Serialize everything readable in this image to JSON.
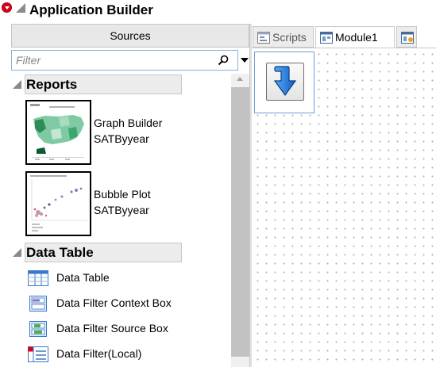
{
  "title": "Application Builder",
  "sources": {
    "header": "Sources",
    "filter_placeholder": "Filter"
  },
  "sections": {
    "reports": {
      "label": "Reports",
      "items": [
        {
          "line1": "Graph Builder",
          "line2": "SATByyear"
        },
        {
          "line1": "Bubble Plot",
          "line2": "SATByyear"
        }
      ]
    },
    "data_table": {
      "label": "Data Table",
      "items": [
        {
          "label": "Data Table"
        },
        {
          "label": "Data Filter Context Box"
        },
        {
          "label": "Data Filter Source Box"
        },
        {
          "label": "Data Filter(Local)"
        }
      ]
    }
  },
  "tabs": [
    {
      "label": "Scripts"
    },
    {
      "label": "Module1"
    }
  ],
  "colors": {
    "accent_blue": "#1f6fd1",
    "title_red": "#d9001b"
  }
}
